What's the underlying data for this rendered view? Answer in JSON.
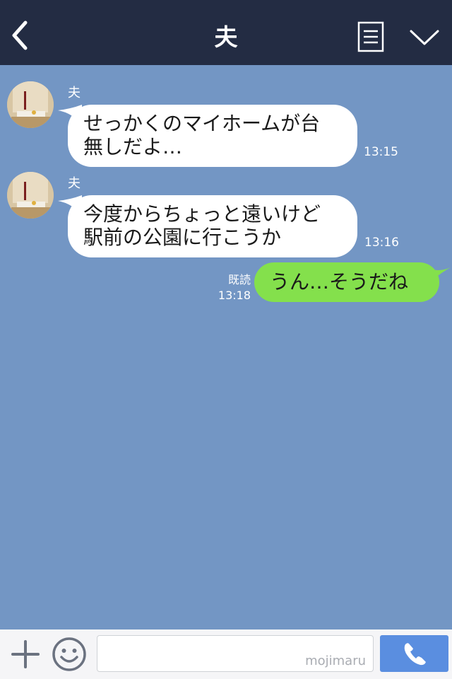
{
  "header": {
    "title": "夫",
    "back_icon": "chevron-left-icon",
    "memo_icon": "document-icon",
    "menu_icon": "chevron-down-icon"
  },
  "messages": [
    {
      "direction": "in",
      "sender": "夫",
      "text": "せっかくのマイホームが台\n無しだよ…",
      "time": "13:15"
    },
    {
      "direction": "in",
      "sender": "夫",
      "text": "今度からちょっと遠いけど\n駅前の公園に行こうか",
      "time": "13:16"
    },
    {
      "direction": "out",
      "read_label": "既読",
      "text": "うん…そうだね",
      "time": "13:18"
    }
  ],
  "footer": {
    "input_placeholder": "mojimaru",
    "plus_icon": "plus-icon",
    "emoji_icon": "smiley-icon",
    "call_icon": "phone-icon"
  },
  "colors": {
    "header_bg": "#232c43",
    "chat_bg": "#7396c4",
    "incoming_bubble": "#ffffff",
    "outgoing_bubble": "#84e04c",
    "call_button": "#5a8ee0"
  }
}
